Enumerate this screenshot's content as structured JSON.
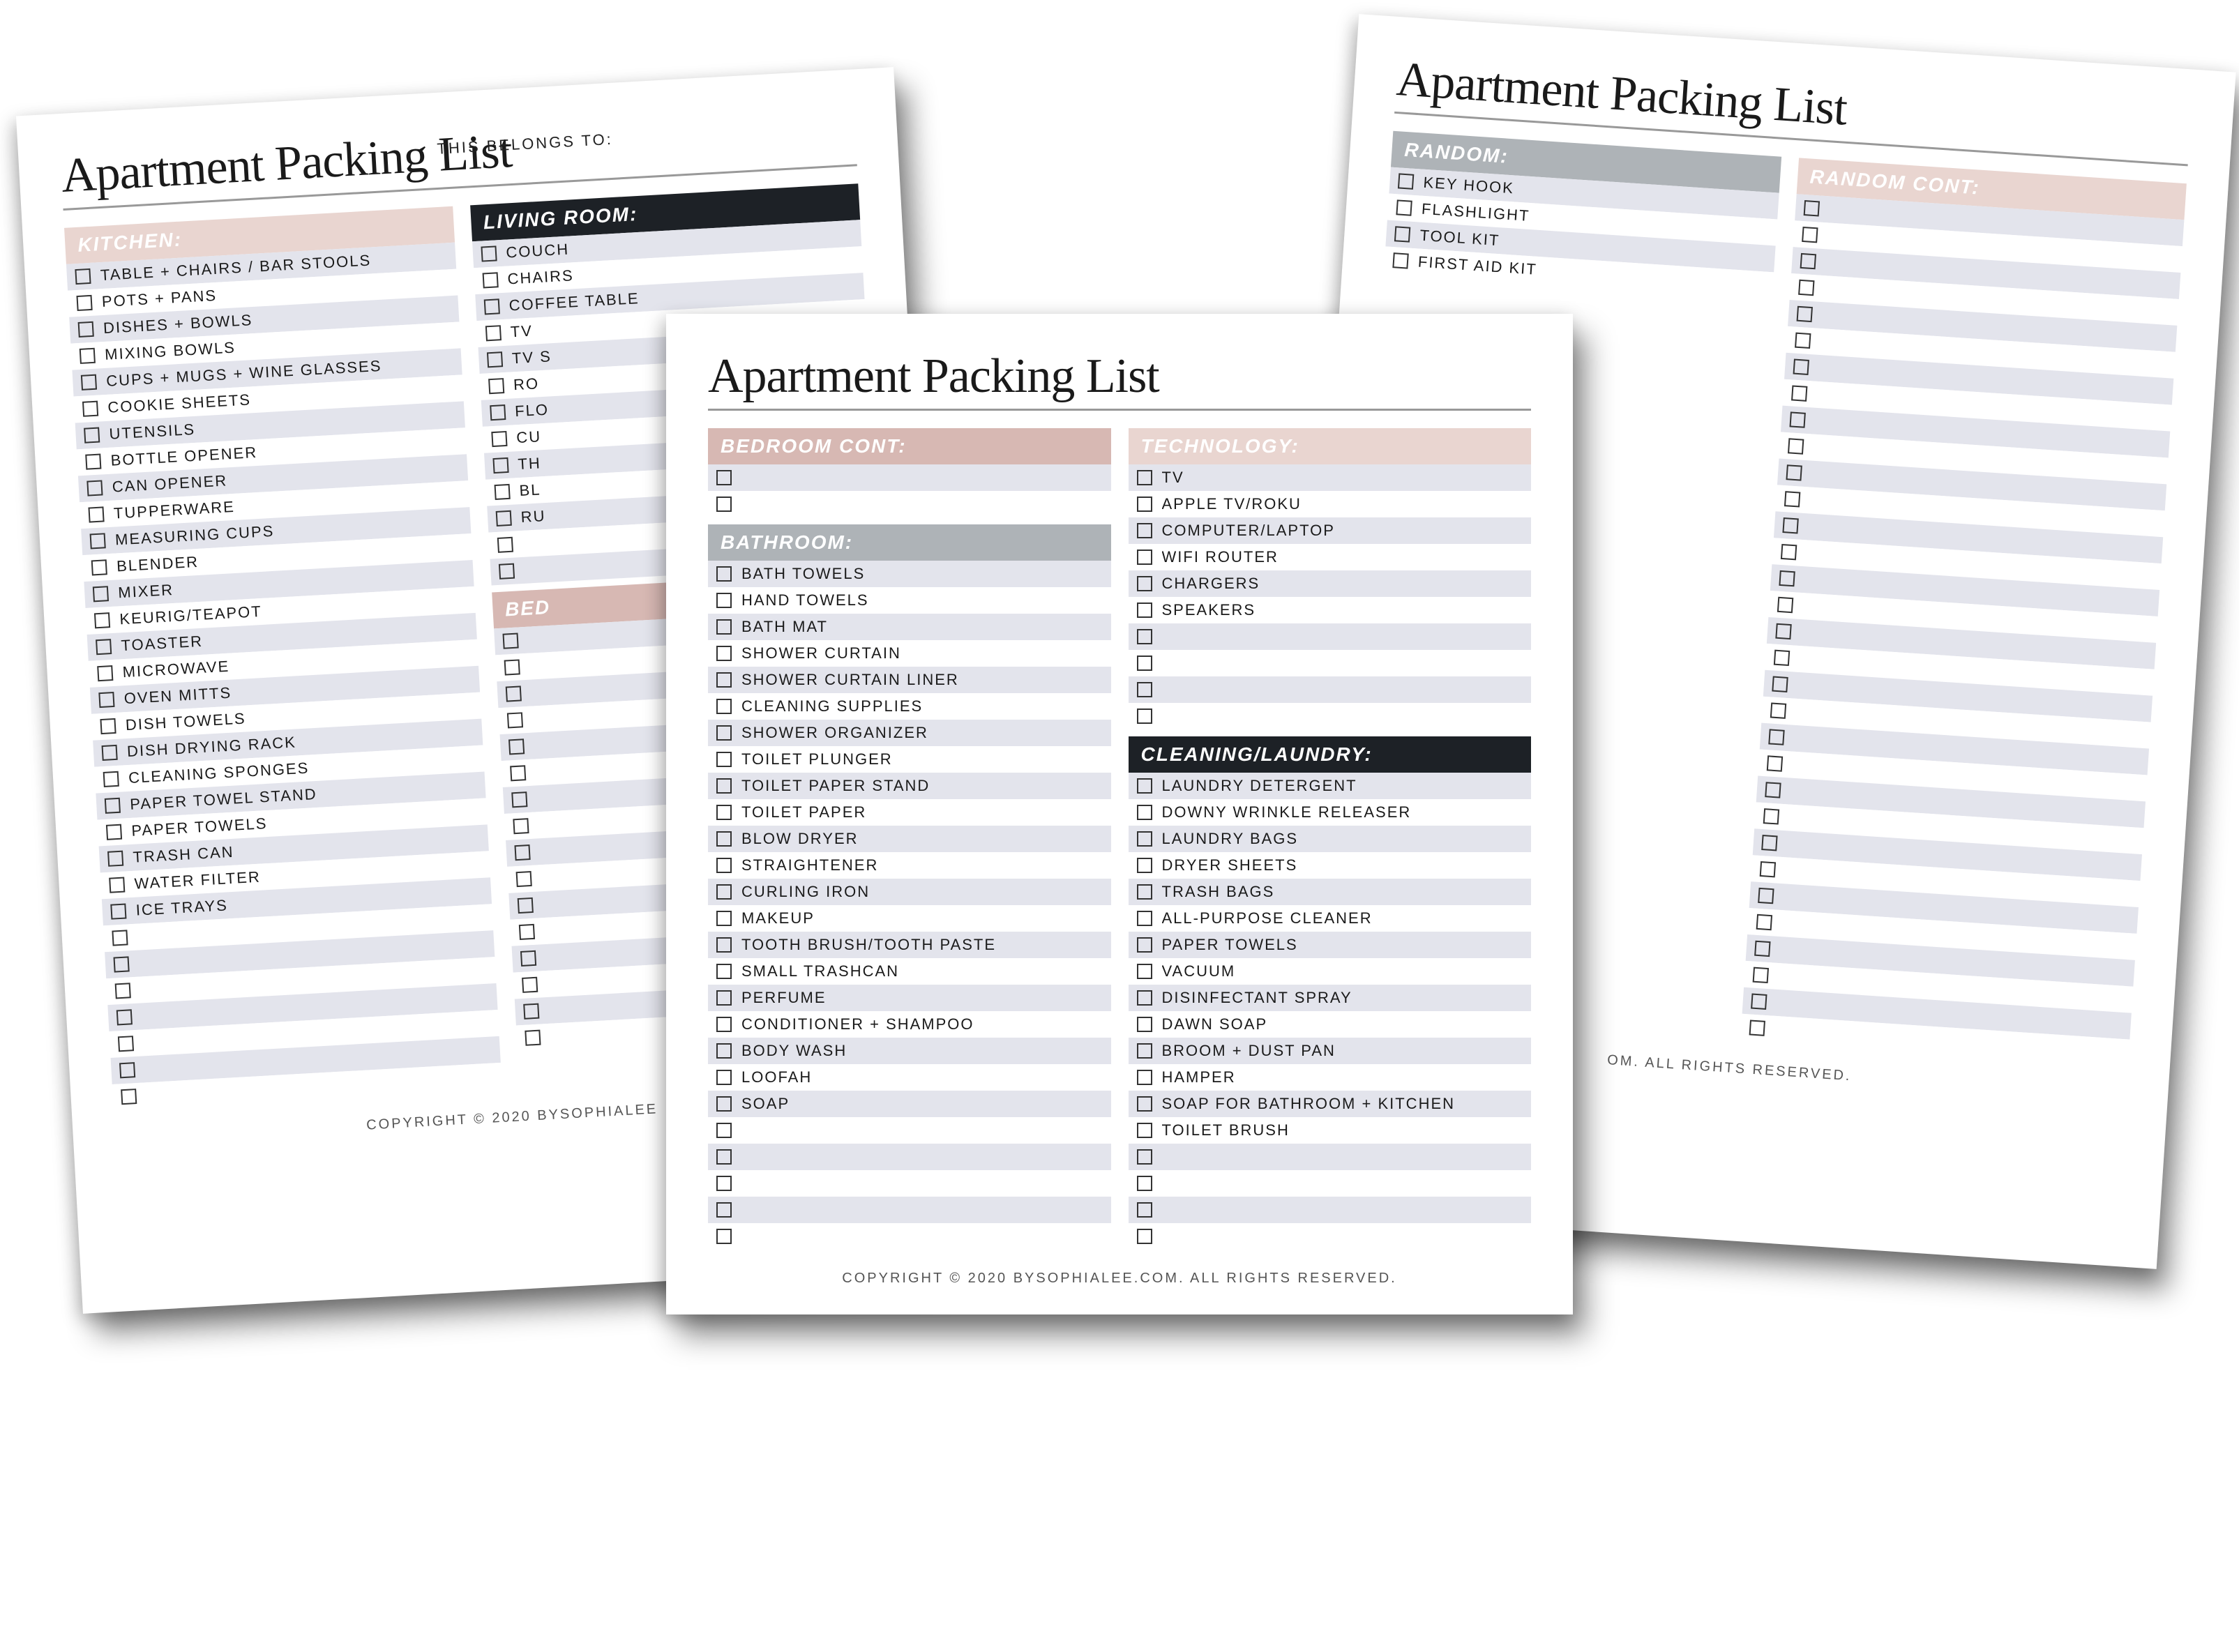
{
  "title": "Apartment Packing List",
  "belongs_to": "THIS BELONGS TO:",
  "footer_full": "COPYRIGHT © 2020 BYSOPHIALEE.COM. ALL RIGHTS RESERVED.",
  "footer_partial_left": "COPYRIGHT © 2020 BYSOPHIALEE",
  "footer_partial_right": "OM. ALL RIGHTS RESERVED.",
  "pages": {
    "left": {
      "left_col": [
        {
          "header": "KITCHEN:",
          "style": "pink",
          "items": [
            "TABLE + CHAIRS / BAR STOOLS",
            "POTS + PANS",
            "DISHES + BOWLS",
            "MIXING BOWLS",
            "CUPS + MUGS + WINE GLASSES",
            "COOKIE SHEETS",
            "UTENSILS",
            "BOTTLE OPENER",
            "CAN OPENER",
            "TUPPERWARE",
            "MEASURING CUPS",
            "BLENDER",
            "MIXER",
            "KEURIG/TEAPOT",
            "TOASTER",
            "MICROWAVE",
            "OVEN MITTS",
            "DISH TOWELS",
            "DISH DRYING RACK",
            "CLEANING SPONGES",
            "PAPER TOWEL STAND",
            "PAPER TOWELS",
            "TRASH CAN",
            "WATER FILTER",
            "ICE TRAYS",
            "",
            "",
            "",
            "",
            "",
            "",
            ""
          ]
        }
      ],
      "right_col": [
        {
          "header": "LIVING ROOM:",
          "style": "black",
          "items": [
            "COUCH",
            "CHAIRS",
            "COFFEE TABLE",
            "TV",
            "TV S",
            "RO",
            "FLO",
            "CU",
            "TH",
            "BL",
            "RU",
            "",
            ""
          ]
        },
        {
          "header": "BED",
          "style": "darkpink",
          "items": [
            "",
            "",
            "",
            "",
            "",
            "",
            "",
            "",
            "",
            "",
            "",
            "",
            "",
            "",
            "",
            ""
          ]
        }
      ]
    },
    "center": {
      "left_col": [
        {
          "header": "BEDROOM CONT:",
          "style": "darkpink",
          "items": [
            "",
            ""
          ]
        },
        {
          "header": "BATHROOM:",
          "style": "gray",
          "items": [
            "BATH TOWELS",
            "HAND TOWELS",
            "BATH MAT",
            "SHOWER CURTAIN",
            "SHOWER CURTAIN LINER",
            "CLEANING SUPPLIES",
            "SHOWER ORGANIZER",
            "TOILET PLUNGER",
            "TOILET PAPER STAND",
            "TOILET PAPER",
            "BLOW DRYER",
            "STRAIGHTENER",
            "CURLING IRON",
            "MAKEUP",
            "TOOTH BRUSH/TOOTH PASTE",
            "SMALL TRASHCAN",
            "PERFUME",
            "CONDITIONER + SHAMPOO",
            "BODY WASH",
            "LOOFAH",
            "SOAP",
            "",
            "",
            "",
            "",
            ""
          ]
        }
      ],
      "right_col": [
        {
          "header": "TECHNOLOGY:",
          "style": "pink",
          "items": [
            "TV",
            "APPLE TV/ROKU",
            "COMPUTER/LAPTOP",
            "WIFI ROUTER",
            "CHARGERS",
            "SPEAKERS",
            "",
            "",
            "",
            ""
          ]
        },
        {
          "header": "CLEANING/LAUNDRY:",
          "style": "black",
          "items": [
            "LAUNDRY DETERGENT",
            "DOWNY WRINKLE RELEASER",
            "LAUNDRY BAGS",
            "DRYER SHEETS",
            "TRASH BAGS",
            "ALL-PURPOSE CLEANER",
            "PAPER TOWELS",
            "VACUUM",
            "DISINFECTANT SPRAY",
            "DAWN SOAP",
            "BROOM + DUST PAN",
            "HAMPER",
            "SOAP FOR BATHROOM + KITCHEN",
            "TOILET BRUSH",
            "",
            "",
            "",
            ""
          ]
        }
      ]
    },
    "right": {
      "left_col": [
        {
          "header": "RANDOM:",
          "style": "gray",
          "items": [
            "KEY HOOK",
            "FLASHLIGHT",
            "TOOL KIT",
            "FIRST AID KIT"
          ]
        }
      ],
      "right_col": [
        {
          "header": "RANDOM CONT:",
          "style": "pink",
          "items": [
            "",
            "",
            "",
            "",
            "",
            "",
            "",
            "",
            "",
            "",
            "",
            "",
            "",
            "",
            "",
            "",
            "",
            "",
            "",
            "",
            "",
            "",
            "",
            "",
            "",
            "",
            "",
            "",
            "",
            "",
            "",
            ""
          ]
        }
      ]
    }
  }
}
